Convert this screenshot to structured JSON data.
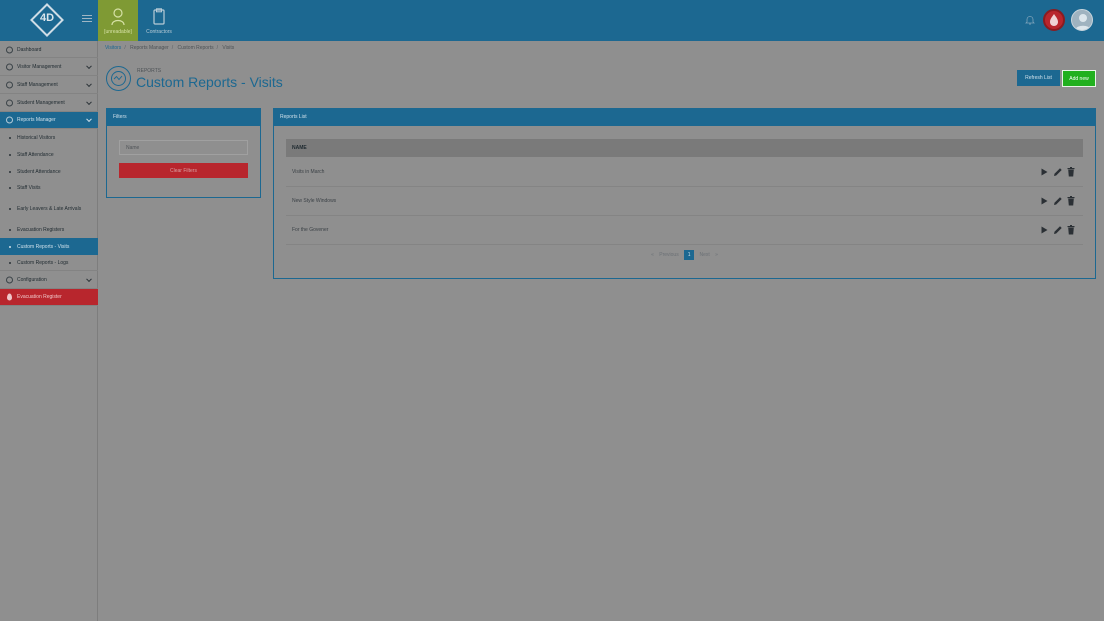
{
  "header": {
    "logo_text": "4D",
    "nav_tiles": [
      {
        "label": "[unreadable]",
        "icon": "visitor-icon"
      },
      {
        "label": "Contractors",
        "icon": "clipboard-icon"
      }
    ],
    "icons": [
      "hamburger-icon",
      "bell-icon",
      "fire-alert-icon",
      "user-avatar-icon"
    ]
  },
  "sidebar": {
    "items": [
      {
        "label": "Dashboard",
        "icon": "dashboard-icon"
      },
      {
        "label": "Visitor Management",
        "icon": "visitor-icon"
      },
      {
        "label": "Staff Management",
        "icon": "staff-icon"
      },
      {
        "label": "Student Management",
        "icon": "student-icon"
      },
      {
        "label": "Reports Manager",
        "icon": "reports-icon"
      }
    ],
    "reports_sub": [
      {
        "label": "Historical Visitors"
      },
      {
        "label": "Staff Attendance"
      },
      {
        "label": "Student Attendance"
      },
      {
        "label": "Staff Visits"
      },
      {
        "label": "Early Leavers & Late Arrivals"
      },
      {
        "label": "Evacuation Registers"
      },
      {
        "label": "Custom Reports - Visits"
      },
      {
        "label": "Custom Reports - Logs"
      }
    ],
    "configuration": {
      "label": "Configuration",
      "icon": "gear-icon"
    },
    "evacuation": {
      "label": "Evacuation Register",
      "icon": "fire-icon"
    }
  },
  "breadcrumb": [
    "Visitors",
    "Reports Manager",
    "Custom Reports",
    "Visits"
  ],
  "page": {
    "kicker": "REPORTS",
    "title": "Custom Reports - Visits"
  },
  "actions": {
    "refresh_label": "Refresh List",
    "add_label": "Add new"
  },
  "filters": {
    "title": "Filters",
    "name_placeholder": "Name",
    "clear_label": "Clear Filters"
  },
  "reports_list": {
    "title": "Reports List",
    "column_header": "NAME",
    "rows": [
      {
        "name": "Visits in March"
      },
      {
        "name": "New Style Windows"
      },
      {
        "name": "For the Govener"
      }
    ],
    "row_actions": [
      "play-icon",
      "edit-icon",
      "delete-icon"
    ]
  },
  "pagination": {
    "prev_label": "Previous",
    "current": "1",
    "next_label": "Next",
    "prev_arrow": "«",
    "next_arrow": "»"
  },
  "colors": {
    "brand_blue": "#1c6891",
    "danger_red": "#b8262d",
    "success_green": "#21b01e",
    "active_tile": "#7f9a34"
  }
}
